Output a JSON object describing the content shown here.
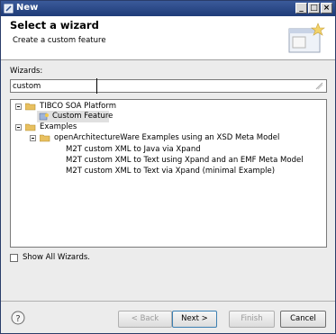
{
  "window": {
    "title": "New",
    "controls": {
      "minimize": "_",
      "maximize": "□",
      "close": "×"
    }
  },
  "banner": {
    "heading": "Select a wizard",
    "description": "Create a custom feature"
  },
  "wizards": {
    "label": "Wizards:",
    "filter_value": "custom"
  },
  "tree": {
    "items": [
      {
        "label": "TIBCO SOA Platform"
      },
      {
        "label": "Custom Feature"
      },
      {
        "label": "Examples"
      },
      {
        "label": "openArchitectureWare Examples using an XSD Meta Model"
      },
      {
        "label": "M2T custom XML to Java via Xpand"
      },
      {
        "label": "M2T custom XML to Text using Xpand and an EMF Meta Model"
      },
      {
        "label": "M2T custom XML to Text via Xpand (minimal Example)"
      }
    ]
  },
  "show_all": {
    "label": "Show All Wizards.",
    "checked": false
  },
  "buttons": {
    "back": "< Back",
    "next": "Next >",
    "finish": "Finish",
    "cancel": "Cancel",
    "help": "?"
  },
  "colors": {
    "titlebar": "#1f3c78",
    "folder": "#e8c060",
    "selection": "#e0e0e0"
  }
}
